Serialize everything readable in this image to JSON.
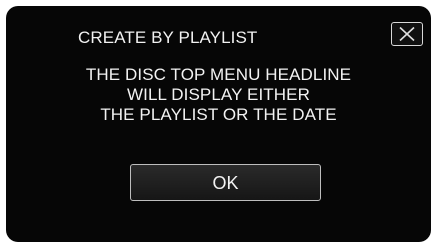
{
  "dialog": {
    "title": "CREATE BY PLAYLIST",
    "close_icon": "close-x-icon",
    "message_lines": [
      "THE DISC TOP MENU HEADLINE",
      "WILL DISPLAY EITHER",
      "THE PLAYLIST OR THE DATE"
    ],
    "ok_label": "OK"
  },
  "colors": {
    "screen_background": "#060606",
    "text": "#f2f2f2",
    "button_border": "#bdbdbd"
  }
}
